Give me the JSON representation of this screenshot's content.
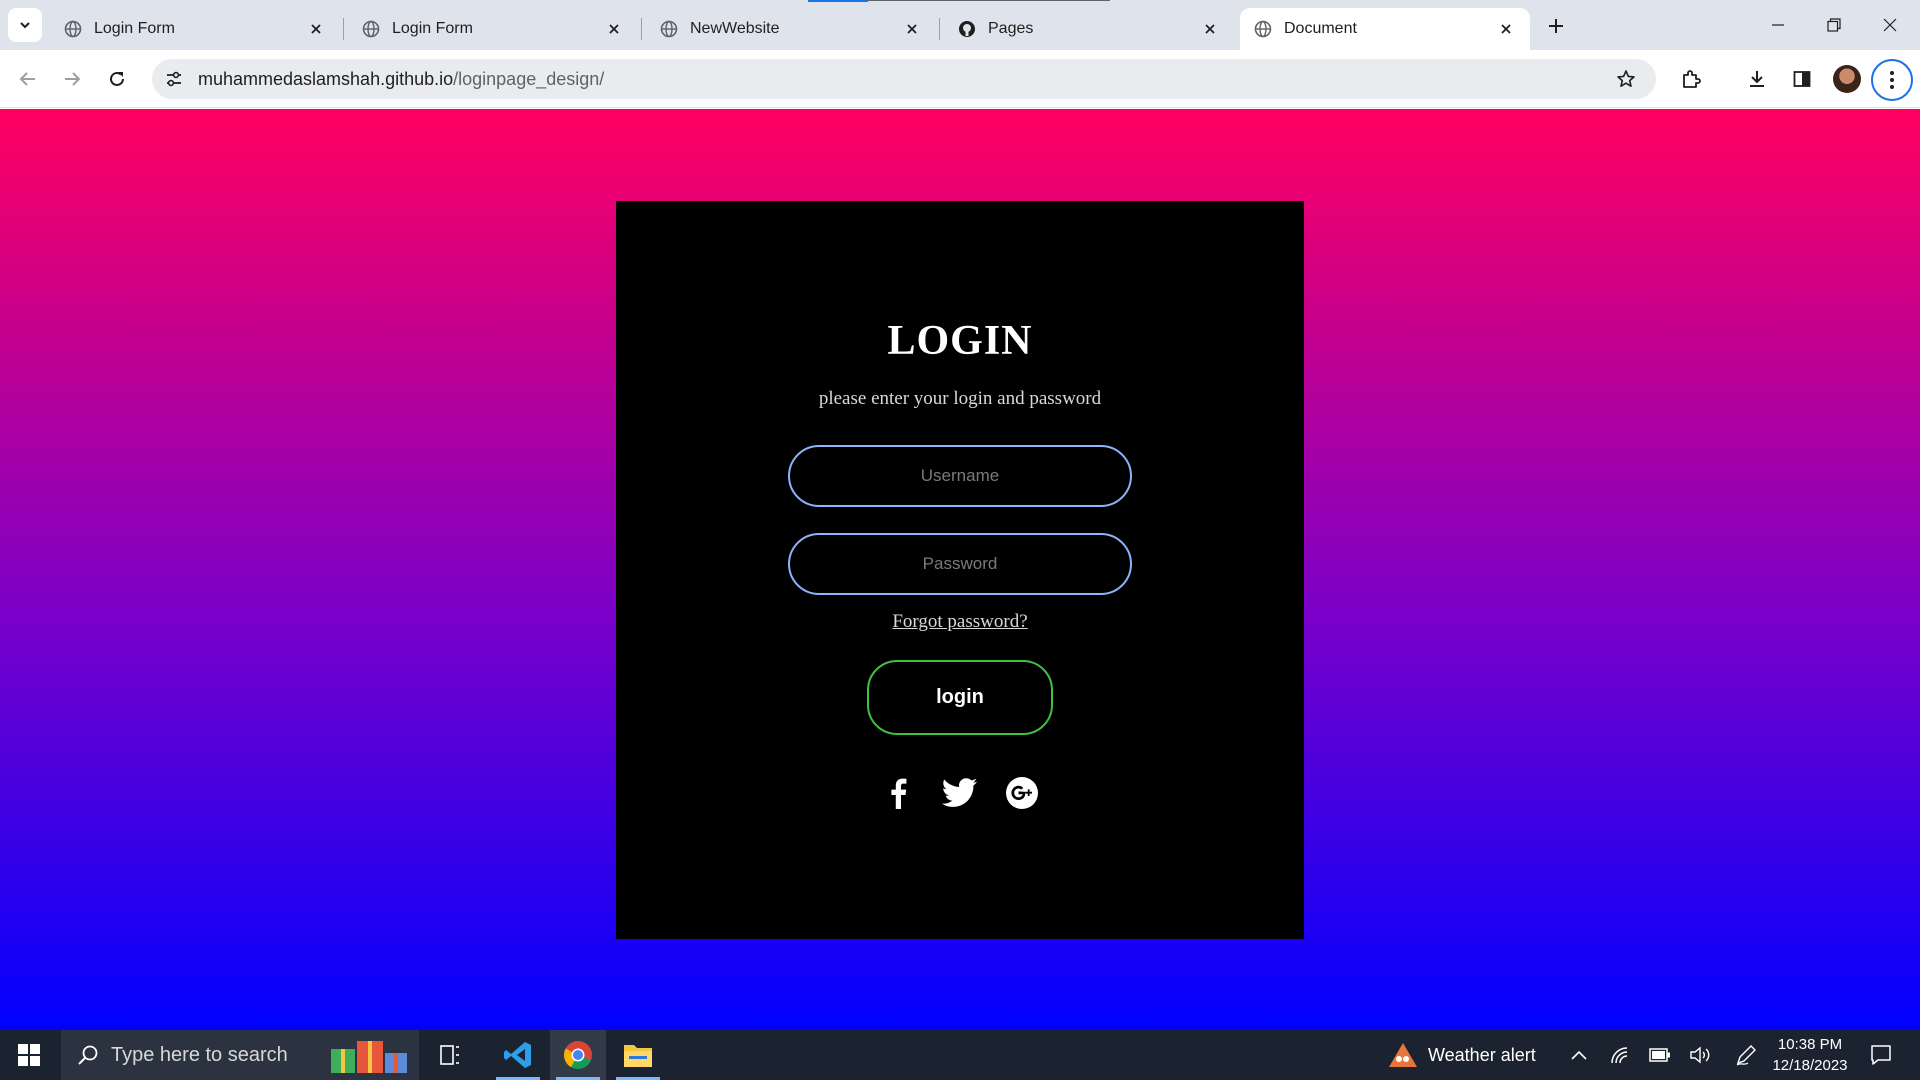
{
  "browser": {
    "tabs": [
      {
        "title": "Login Form",
        "active": false
      },
      {
        "title": "Login Form",
        "active": false
      },
      {
        "title": "NewWebsite",
        "active": false
      },
      {
        "title": "Pages",
        "active": false
      },
      {
        "title": "Document",
        "active": true
      }
    ],
    "address_bar": {
      "domain": "muhammedaslamshah.github.io",
      "path": "/loginpage_design/"
    }
  },
  "page": {
    "background_gradient": [
      "#ff0060",
      "#7a00c9",
      "#0000ff"
    ],
    "login_card": {
      "heading": "LOGIN",
      "subtitle": "please enter your login and password",
      "username_placeholder": "Username",
      "password_placeholder": "Password",
      "forgot_link": "Forgot password?",
      "login_button": "login",
      "social_icons": [
        "facebook-icon",
        "twitter-icon",
        "google-plus-icon"
      ],
      "input_border_color": "#8fb3ff",
      "button_border_color": "#3ec13e"
    }
  },
  "taskbar": {
    "search_placeholder": "Type here to search",
    "weather": "Weather alert",
    "time": "10:38 PM",
    "date": "12/18/2023"
  }
}
